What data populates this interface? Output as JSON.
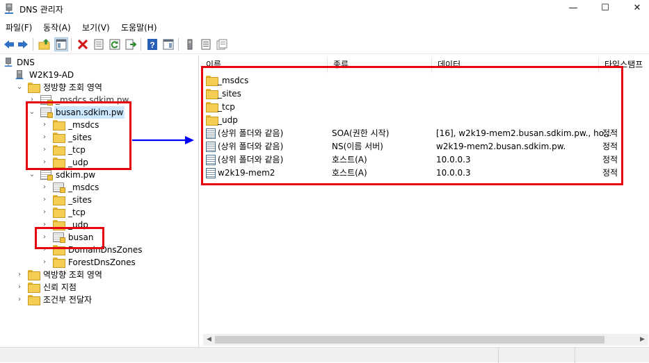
{
  "window": {
    "title": "DNS 관리자",
    "minimize_glyph": "—",
    "maximize_glyph": "☐",
    "close_glyph": "✕"
  },
  "menu": [
    "파일(F)",
    "동작(A)",
    "보기(V)",
    "도움말(H)"
  ],
  "toolbar": {
    "buttons": [
      "back-icon",
      "forward-icon",
      "up-folder-icon",
      "show-hide-tree-icon",
      "delete-icon",
      "properties-icon",
      "refresh-icon",
      "export-list-icon",
      "help-icon",
      "action-pane-icon",
      "server-icon",
      "list-icon",
      "zone-icon"
    ]
  },
  "tree": {
    "root": "DNS",
    "server": "W2K19-AD",
    "forward_zones": "정방향 조회 영역",
    "msdcs_zone": "_msdcs.sdkim.pw",
    "busan_zone": "busan.sdkim.pw",
    "busan_children": [
      "_msdcs",
      "_sites",
      "_tcp",
      "_udp"
    ],
    "sdkim_zone": "sdkim.pw",
    "sdkim_children": [
      "_msdcs",
      "_sites",
      "_tcp",
      "_udp"
    ],
    "busan_delegation": "busan",
    "domain_dns_zones": "DomainDnsZones",
    "forest_dns_zones": "ForestDnsZones",
    "reverse_zones": "역방향 조회 영역",
    "trust_points": "신뢰 지점",
    "conditional_forwarders": "조건부 전달자"
  },
  "list": {
    "columns": [
      "이름",
      "종류",
      "데이터",
      "타임스탬프"
    ],
    "rows": [
      {
        "icon": "folder",
        "name": "_msdcs",
        "type": "",
        "data": "",
        "timestamp": ""
      },
      {
        "icon": "folder",
        "name": "_sites",
        "type": "",
        "data": "",
        "timestamp": ""
      },
      {
        "icon": "folder",
        "name": "_tcp",
        "type": "",
        "data": "",
        "timestamp": ""
      },
      {
        "icon": "folder",
        "name": "_udp",
        "type": "",
        "data": "",
        "timestamp": ""
      },
      {
        "icon": "record",
        "name": "(상위 폴더와 같음)",
        "type": "SOA(권한 시작)",
        "data": "[16], w2k19-mem2.busan.sdkim.pw., ho...",
        "timestamp": "정적"
      },
      {
        "icon": "record",
        "name": "(상위 폴더와 같음)",
        "type": "NS(이름 서버)",
        "data": "w2k19-mem2.busan.sdkim.pw.",
        "timestamp": "정적"
      },
      {
        "icon": "record",
        "name": "(상위 폴더와 같음)",
        "type": "호스트(A)",
        "data": "10.0.0.3",
        "timestamp": "정적"
      },
      {
        "icon": "record",
        "name": "w2k19-mem2",
        "type": "호스트(A)",
        "data": "10.0.0.3",
        "timestamp": "정적"
      }
    ]
  },
  "scrollbar": {
    "left_arrow": "◀",
    "right_arrow": "▶"
  },
  "colors": {
    "highlight_box": "#e8000e",
    "arrow": "#0000ff",
    "selection": "#cce8ff",
    "folder": "#f4cd55"
  }
}
